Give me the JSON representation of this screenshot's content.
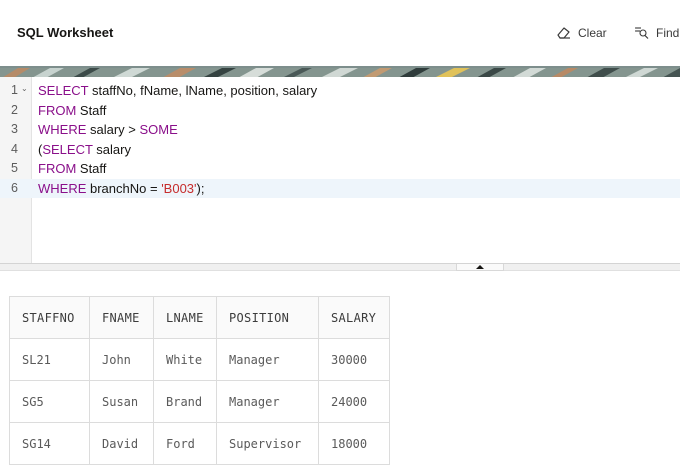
{
  "header": {
    "title": "SQL Worksheet",
    "clear_label": "Clear",
    "find_label": "Find"
  },
  "editor": {
    "lines": [
      {
        "num": "1",
        "parts": [
          {
            "t": "SELECT",
            "k": "kw"
          },
          {
            "t": " staffNo, fName, lName, position, salary",
            "k": ""
          }
        ]
      },
      {
        "num": "2",
        "parts": [
          {
            "t": "FROM",
            "k": "kw"
          },
          {
            "t": " Staff",
            "k": ""
          }
        ]
      },
      {
        "num": "3",
        "parts": [
          {
            "t": "WHERE",
            "k": "kw"
          },
          {
            "t": " salary > ",
            "k": ""
          },
          {
            "t": "SOME",
            "k": "kw"
          }
        ]
      },
      {
        "num": "4",
        "parts": [
          {
            "t": "(",
            "k": ""
          },
          {
            "t": "SELECT",
            "k": "kw"
          },
          {
            "t": " salary",
            "k": ""
          }
        ]
      },
      {
        "num": "5",
        "parts": [
          {
            "t": "FROM",
            "k": "kw"
          },
          {
            "t": " Staff",
            "k": ""
          }
        ]
      },
      {
        "num": "6",
        "parts": [
          {
            "t": "WHERE",
            "k": "kw"
          },
          {
            "t": " branchNo = ",
            "k": ""
          },
          {
            "t": "'B003'",
            "k": "str"
          },
          {
            "t": ");",
            "k": ""
          }
        ]
      }
    ],
    "active_line": 6
  },
  "results": {
    "columns": [
      "STAFFNO",
      "FNAME",
      "LNAME",
      "POSITION",
      "SALARY"
    ],
    "rows": [
      [
        "SL21",
        "John",
        "White",
        "Manager",
        "30000"
      ],
      [
        "SG5",
        "Susan",
        "Brand",
        "Manager",
        "24000"
      ],
      [
        "SG14",
        "David",
        "Ford",
        "Supervisor",
        "18000"
      ]
    ]
  },
  "colors": {
    "keyword": "#8a0f8a",
    "string": "#c62c2c",
    "active_line": "#eef5fb"
  },
  "icons": {
    "clear": "eraser-icon",
    "find": "find-icon",
    "fold": "fold-chevron-icon"
  }
}
